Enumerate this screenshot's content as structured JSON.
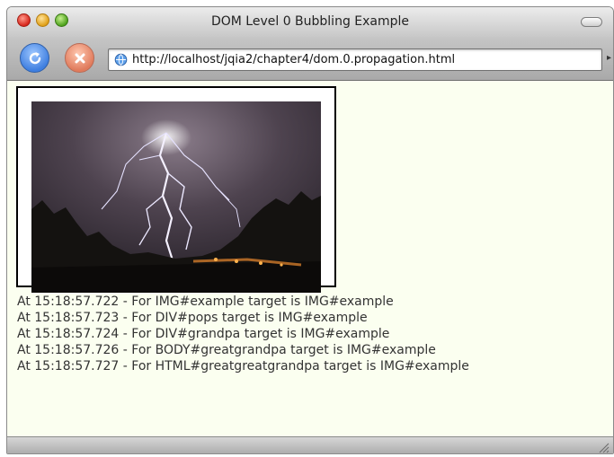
{
  "window": {
    "title": "DOM Level 0 Bubbling Example"
  },
  "toolbar": {
    "url": "http://localhost/jqia2/chapter4/dom.0.propagation.html"
  },
  "content": {
    "image": {
      "semantic": "lightning-photo"
    },
    "log_lines": [
      "At 15:18:57.722 - For IMG#example target is IMG#example",
      "At 15:18:57.723 - For DIV#pops target is IMG#example",
      "At 15:18:57.724 - For DIV#grandpa target is IMG#example",
      "At 15:18:57.726 - For BODY#greatgrandpa target is IMG#example",
      "At 15:18:57.727 - For HTML#greatgreatgrandpa target is IMG#example"
    ]
  },
  "icons": {
    "reload": "reload-icon",
    "stop": "stop-icon",
    "page": "page-globe-icon"
  },
  "colors": {
    "page_bg": "#fbfff0",
    "log_text": "#333333"
  }
}
